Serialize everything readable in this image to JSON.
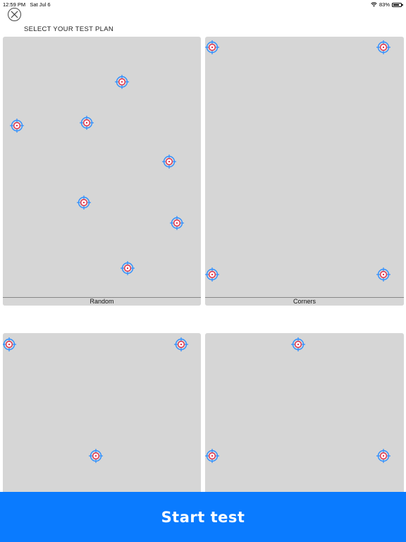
{
  "status_bar": {
    "time": "12:59 PM",
    "date": "Sat Jul 6",
    "battery": "83%",
    "battery_level": 0.83
  },
  "screen": {
    "heading": "SELECT YOUR TEST PLAN",
    "close_icon": "close-icon"
  },
  "colors": {
    "card_bg": "#d6d6d6",
    "target_outer": "#2f8fff",
    "target_inner": "#e0203a",
    "primary": "#0a7bff"
  },
  "plans": [
    {
      "name": "random",
      "label": "Random"
    },
    {
      "name": "corners",
      "label": "Corners"
    },
    {
      "name": "plan-3",
      "label": ""
    },
    {
      "name": "plan-4",
      "label": ""
    }
  ],
  "start_button": {
    "label": "Start test"
  }
}
